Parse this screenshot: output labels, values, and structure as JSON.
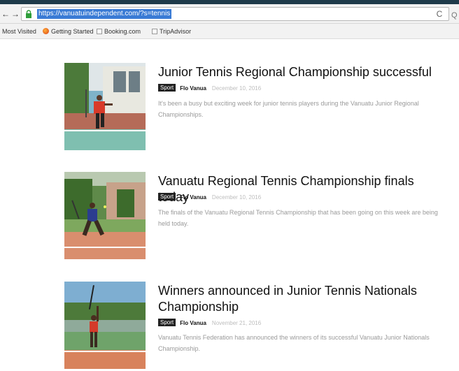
{
  "browser": {
    "back_glyph": "←",
    "forward_glyph": "→",
    "url": "https://vanuatuindependent.com/?s=tennis",
    "reload_glyph": "C",
    "search_glyph": "Q",
    "bookmarks": [
      {
        "label": "Most Visited"
      },
      {
        "label": "Getting Started"
      },
      {
        "label": "Booking.com"
      },
      {
        "label": "TripAdvisor"
      }
    ]
  },
  "articles": [
    {
      "title": "Junior Tennis Regional Championship successful",
      "category": "Sport",
      "author": "Flo Vanua",
      "date": "December 10, 2016",
      "excerpt": "It's been a busy but exciting week for junior tennis players during the Vanuatu Junior Regional Championships."
    },
    {
      "title": "Vanuatu Regional Tennis Championship finals today",
      "category": "Sport",
      "author": "Flo Vanua",
      "date": "December 10, 2016",
      "excerpt": "The finals of the Vanuatu Regional Tennis Championship that has been going on this week are being held today."
    },
    {
      "title": "Winners announced in Junior Tennis Nationals Championship",
      "category": "Sport",
      "author": "Flo Vanua",
      "date": "November 21, 2016",
      "excerpt": "Vanuatu Tennis Federation has announced the winners of its successful Vanuatu Junior Nationals Championship."
    }
  ]
}
